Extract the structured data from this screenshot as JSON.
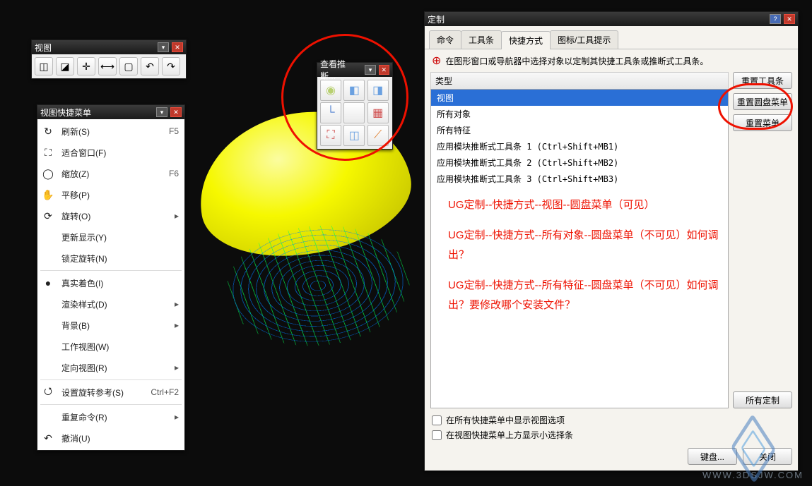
{
  "watermark": {
    "text": "WWW.3DSJW.COM"
  },
  "view_toolbar": {
    "title": "视图",
    "buttons": [
      {
        "name": "fit-view-icon",
        "glyph": "◫"
      },
      {
        "name": "zoom-icon",
        "glyph": "◪"
      },
      {
        "name": "trihedron-icon",
        "glyph": "✛"
      },
      {
        "name": "extents-icon",
        "glyph": "⟷"
      },
      {
        "name": "display-mode-icon",
        "glyph": "▢"
      },
      {
        "name": "undo-icon",
        "glyph": "↶"
      },
      {
        "name": "redo-icon",
        "glyph": "↷"
      }
    ]
  },
  "context_menu": {
    "title": "视图快捷菜单",
    "items": [
      {
        "icon": "↻",
        "label": "刷新(S)",
        "accel": "F5",
        "name": "refresh-item"
      },
      {
        "icon": "⛶",
        "label": "适合窗口(F)",
        "name": "fit-window-item"
      },
      {
        "icon": "◯",
        "label": "缩放(Z)",
        "accel": "F6",
        "name": "zoom-item"
      },
      {
        "icon": "✋",
        "label": "平移(P)",
        "name": "pan-item"
      },
      {
        "icon": "⟳",
        "label": "旋转(O)",
        "sub": true,
        "name": "rotate-item"
      },
      {
        "label": "更新显示(Y)",
        "name": "update-display-item"
      },
      {
        "label": "锁定旋转(N)",
        "sep_after": true,
        "name": "lock-rotation-item"
      },
      {
        "icon": "●",
        "label": "真实着色(I)",
        "name": "true-shading-item"
      },
      {
        "label": "渲染样式(D)",
        "sub": true,
        "name": "render-style-item"
      },
      {
        "label": "背景(B)",
        "sub": true,
        "name": "background-item"
      },
      {
        "label": "工作视图(W)",
        "name": "work-view-item"
      },
      {
        "label": "定向视图(R)",
        "sub": true,
        "sep_after": true,
        "name": "orient-view-item"
      },
      {
        "icon": "⭯",
        "label": "设置旋转参考(S)",
        "accel": "Ctrl+F2",
        "sep_after": true,
        "name": "set-rotation-ref-item"
      },
      {
        "label": "重复命令(R)",
        "sub": true,
        "name": "repeat-cmd-item"
      },
      {
        "icon": "↶",
        "label": "撤消(U)",
        "name": "undo-item"
      }
    ]
  },
  "palette": {
    "title": "查看推断...",
    "cells": [
      {
        "name": "sphere-icon",
        "glyph": "◉",
        "color": "#b8d070"
      },
      {
        "name": "cube-shaded-icon",
        "glyph": "◧",
        "color": "#6aa0e0"
      },
      {
        "name": "cube-solid-icon",
        "glyph": "◨",
        "color": "#6aa0e0"
      },
      {
        "name": "axes-icon",
        "glyph": "└",
        "color": "#5080d0"
      },
      {
        "name": "blank-icon",
        "glyph": " ",
        "color": "#999"
      },
      {
        "name": "layout-icon",
        "glyph": "▦",
        "color": "#d05050"
      },
      {
        "name": "fit-icon",
        "glyph": "⛶",
        "color": "#d05050"
      },
      {
        "name": "wireframe-icon",
        "glyph": "◫",
        "color": "#6aa0e0"
      },
      {
        "name": "style-icon",
        "glyph": "⟋",
        "color": "#e08030"
      }
    ]
  },
  "custom_dialog": {
    "title": "定制",
    "tabs": [
      {
        "label": "命令",
        "name": "tab-command"
      },
      {
        "label": "工具条",
        "name": "tab-toolbar"
      },
      {
        "label": "快捷方式",
        "name": "tab-shortcuts",
        "active": true
      },
      {
        "label": "图标/工具提示",
        "name": "tab-icons"
      }
    ],
    "hint": "在图形窗口或导航器中选择对象以定制其快捷工具条或推断式工具条。",
    "list_header": "类型",
    "list_items": [
      {
        "label": "视图",
        "selected": true
      },
      {
        "label": "所有对象"
      },
      {
        "label": "所有特征"
      },
      {
        "label": "应用模块推断式工具条 1 (Ctrl+Shift+MB1)"
      },
      {
        "label": "应用模块推断式工具条 2 (Ctrl+Shift+MB2)"
      },
      {
        "label": "应用模块推断式工具条 3 (Ctrl+Shift+MB3)"
      }
    ],
    "side_buttons": [
      {
        "label": "重置工具条",
        "name": "reset-toolbar-button"
      },
      {
        "label": "重置圆盘菜单",
        "name": "reset-radial-button"
      },
      {
        "label": "重置菜单",
        "name": "reset-menu-button"
      }
    ],
    "all_custom": "所有定制",
    "check1": "在所有快捷菜单中显示视图选项",
    "check2": "在视图快捷菜单上方显示小选择条",
    "foot_keyboard": "键盘...",
    "foot_close": "关闭",
    "annotations": [
      "UG定制--快捷方式--视图--圆盘菜单（可见）",
      "UG定制--快捷方式--所有对象--圆盘菜单（不可见）如何调出？",
      "UG定制--快捷方式--所有特征--圆盘菜单（不可见）如何调出？要修改哪个安装文件？"
    ]
  }
}
